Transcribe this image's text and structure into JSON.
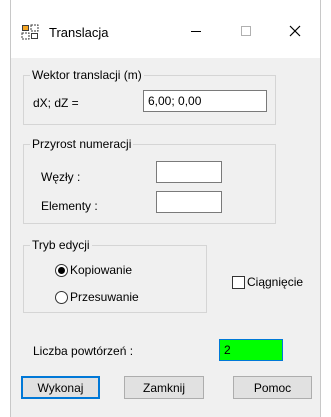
{
  "window": {
    "title": "Translacja"
  },
  "icons": {
    "app": "translation-grid-icon",
    "minimize": "minimize-icon",
    "maximize": "maximize-icon",
    "close": "close-icon"
  },
  "translation_vector": {
    "group_label": "Wektor translacji (m)",
    "field_label": "dX; dZ  =",
    "value": "6,00; 0,00"
  },
  "numbering": {
    "group_label": "Przyrost numeracji",
    "nodes_label": "Węzły :",
    "nodes_value": "",
    "elements_label": "Elementy :",
    "elements_value": ""
  },
  "edit_mode": {
    "group_label": "Tryb edycji",
    "options": [
      {
        "label": "Kopiowanie",
        "selected": true
      },
      {
        "label": "Przesuwanie",
        "selected": false
      }
    ]
  },
  "drag": {
    "label": "Ciągnięcie",
    "checked": false
  },
  "repeat": {
    "label": "Liczba powtórzeń :",
    "value": "2",
    "highlight_color": "#00ff00"
  },
  "buttons": {
    "execute": "Wykonaj",
    "close": "Zamknij",
    "help": "Pomoc"
  },
  "colors": {
    "default_button_border": "#0078d7",
    "dialog_background": "#f0f0f0"
  }
}
